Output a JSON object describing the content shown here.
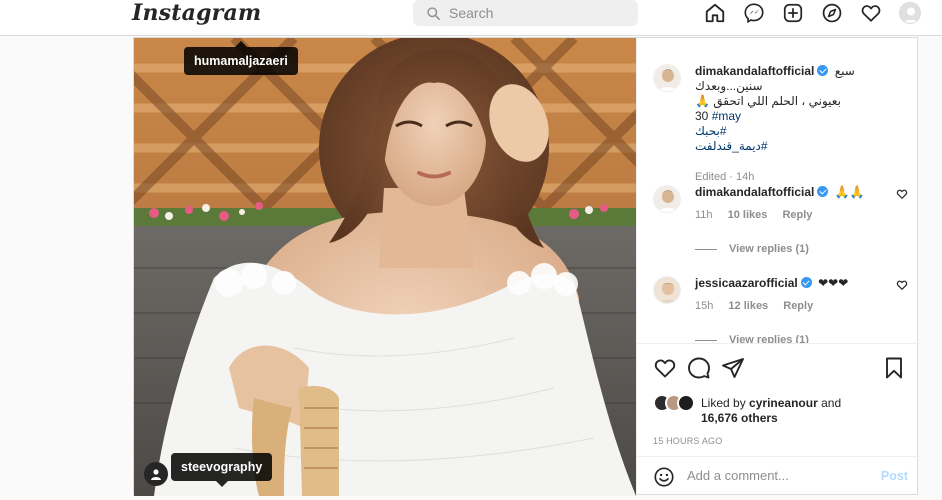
{
  "header": {
    "logo": "Instagram",
    "search_placeholder": "Search",
    "nav_icons": [
      "home-icon",
      "messenger-icon",
      "new-post-icon",
      "explore-icon",
      "activity-heart-icon",
      "profile-avatar"
    ]
  },
  "photo": {
    "tag_top": "humamaljazaeri",
    "tag_bottom": "steevography"
  },
  "caption": {
    "username": "dimakandalaftofficial",
    "line1": "سبع سنين...وبعدك",
    "line2": "بعيوني ، الحلم اللي اتحقق 🙏",
    "line3_num": "30",
    "line3_tag": "#may",
    "line4_tag": "#بحبك",
    "line5_tag": "#ديمة_قندلفت",
    "edited": "Edited · 14h"
  },
  "comments": [
    {
      "username": "dimakandalaftofficial",
      "text": "🙏🙏",
      "time": "11h",
      "likes": "10 likes",
      "reply": "Reply",
      "view_replies": "View replies (1)"
    },
    {
      "username": "jessicaazarofficial",
      "text": "❤❤❤",
      "time": "15h",
      "likes": "12 likes",
      "reply": "Reply",
      "view_replies": "View replies (1)"
    }
  ],
  "likes": {
    "liked_by_prefix": "Liked by",
    "liked_by_user": "cyrineanour",
    "and": "and",
    "others": "16,676 others"
  },
  "post_date": "15 HOURS AGO",
  "add_comment": {
    "placeholder": "Add a comment...",
    "post_label": "Post"
  },
  "colors": {
    "accent": "#3897f0",
    "post_disabled": "#b3dbff",
    "hashtag": "#00376b",
    "muted": "#8e8e8e"
  }
}
